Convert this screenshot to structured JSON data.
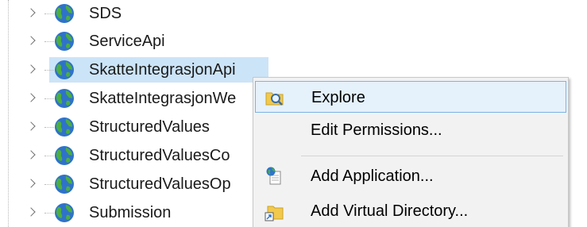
{
  "tree": {
    "items": [
      {
        "label": "SDS",
        "selected": false
      },
      {
        "label": "ServiceApi",
        "selected": false
      },
      {
        "label": "SkatteIntegrasjonApi",
        "selected": true
      },
      {
        "label": "SkatteIntegrasjonWe",
        "selected": false
      },
      {
        "label": "StructuredValues",
        "selected": false
      },
      {
        "label": "StructuredValuesCo",
        "selected": false
      },
      {
        "label": "StructuredValuesOp",
        "selected": false
      },
      {
        "label": "Submission",
        "selected": false
      }
    ],
    "item_icon": "globe-icon",
    "expand_icon": "chevron-right-icon"
  },
  "context_menu": {
    "items": [
      {
        "label": "Explore",
        "icon": "folder-explore-icon",
        "highlighted": true
      },
      {
        "label": "Edit Permissions...",
        "icon": "",
        "highlighted": false
      },
      {
        "label": "Add Application...",
        "icon": "add-application-icon",
        "highlighted": false
      },
      {
        "label": "Add Virtual Directory...",
        "icon": "add-virtual-directory-icon",
        "highlighted": false
      }
    ]
  },
  "colors": {
    "selection": "#cce4f7",
    "menu_highlight": "#e5f1fb",
    "menu_highlight_border": "#7ab3e6",
    "menu_background": "#f2f2f2"
  }
}
